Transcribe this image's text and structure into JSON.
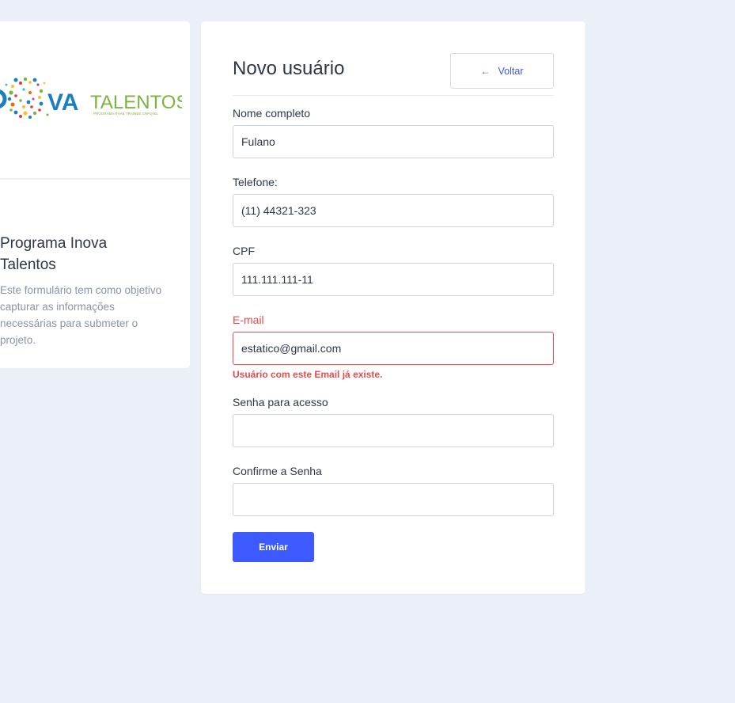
{
  "sidebar": {
    "logo_alt": "Inova Talentos logo",
    "logo_text_main": "VA",
    "logo_text_talentos": "TALENTOS",
    "logo_subtext": "PROGRAMA RHAE TRAINEE CNPq-IEL",
    "title": "Programa Inova Talentos",
    "description": "Este formulário tem como objetivo capturar as informações necessárias para submeter o projeto."
  },
  "form": {
    "title": "Novo usuário",
    "back_label": "Voltar",
    "back_icon": "arrow-left-icon",
    "fields": {
      "name": {
        "label": "Nome completo",
        "value": "Fulano"
      },
      "phone": {
        "label": "Telefone:",
        "value": "(11) 44321-323"
      },
      "cpf": {
        "label": "CPF",
        "value": "111.111.111-11"
      },
      "email": {
        "label": "E-mail",
        "value": "estatico@gmail.com",
        "error": "Usuário com este Email já existe."
      },
      "password": {
        "label": "Senha para acesso",
        "value": ""
      },
      "confirm_password": {
        "label": "Confirme a Senha",
        "value": ""
      }
    },
    "submit_label": "Enviar"
  },
  "colors": {
    "background": "#ebeff7",
    "primary": "#3d5afe",
    "error": "#e74c4c",
    "logo_blue": "#1a7fc1",
    "logo_green": "#7cb342"
  }
}
